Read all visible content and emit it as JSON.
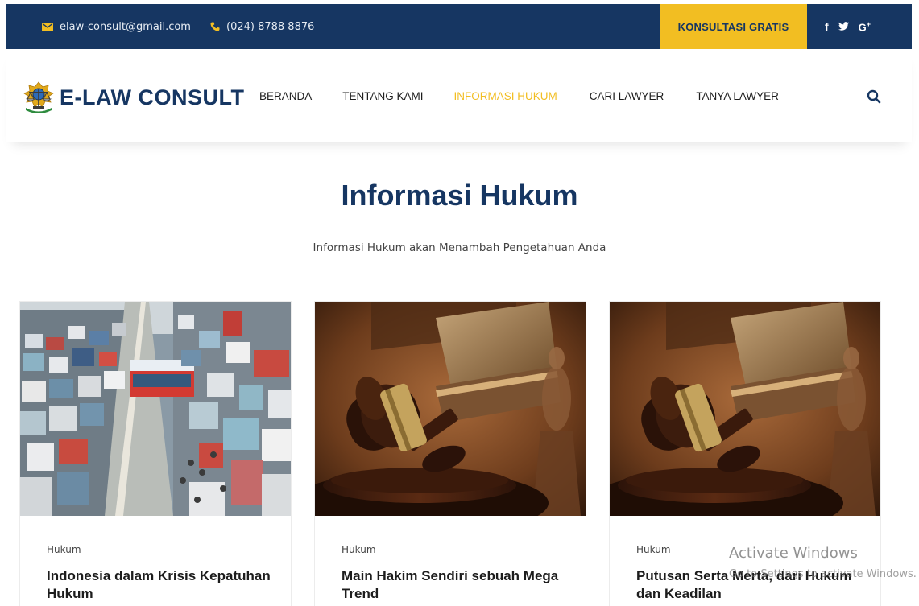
{
  "topbar": {
    "email": "elaw-consult@gmail.com",
    "phone": "(024) 8788 8876",
    "cta_label": "KONSULTASI GRATIS",
    "social": [
      {
        "icon": "facebook-icon",
        "label": "f"
      },
      {
        "icon": "twitter-icon",
        "label": "𝕪"
      },
      {
        "icon": "google-plus-icon",
        "label": "G+"
      }
    ]
  },
  "brand": {
    "name": "E-LAW CONSULT"
  },
  "nav": {
    "items": [
      {
        "label": "BERANDA",
        "active": false
      },
      {
        "label": "TENTANG KAMI",
        "active": false
      },
      {
        "label": "INFORMASI HUKUM",
        "active": true
      },
      {
        "label": "CARI LAWYER",
        "active": false
      },
      {
        "label": "TANYA LAWYER",
        "active": false
      }
    ]
  },
  "hero": {
    "title": "Informasi Hukum",
    "subtitle": "Informasi Hukum akan Menambah Pengetahuan Anda"
  },
  "articles": [
    {
      "category": "Hukum",
      "title": "Indonesia dalam Krisis Kepatuhan Hukum",
      "image": "traffic-jam-photo"
    },
    {
      "category": "Hukum",
      "title": "Main Hakim Sendiri sebuah Mega Trend",
      "image": "gavel-photo"
    },
    {
      "category": "Hukum",
      "title": "Putusan Serta Merta, dari Hukum dan Keadilan",
      "image": "gavel-photo"
    }
  ],
  "watermark": {
    "line1": "Activate Windows",
    "line2": "Go to Settings to activate Windows."
  },
  "colors": {
    "navy": "#163662",
    "accent": "#f2be22"
  }
}
